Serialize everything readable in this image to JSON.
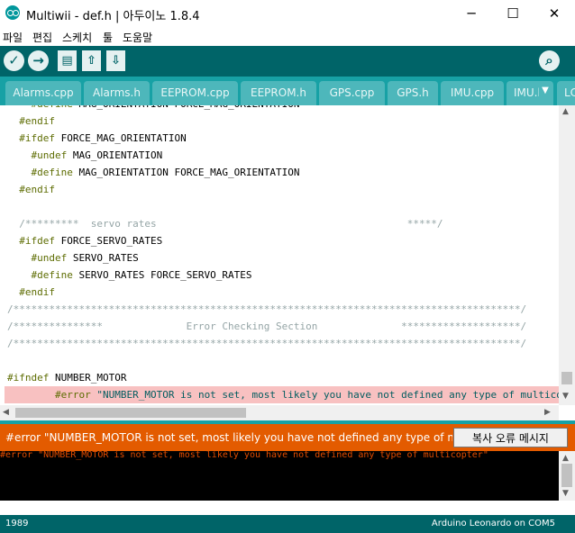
{
  "window": {
    "title": "Multiwii - def.h | 아두이노 1.8.4",
    "minimize": "─",
    "maximize": "☐",
    "close": "✕"
  },
  "menu": [
    "파일",
    "편집",
    "스케치",
    "툴",
    "도움말"
  ],
  "toolbar": {
    "verify_icon": "✓",
    "upload_icon": "→",
    "new_icon": "▤",
    "open_icon": "⇧",
    "save_icon": "⇩",
    "serial_icon": "⌕"
  },
  "tabs": [
    {
      "label": "Alarms.cpp"
    },
    {
      "label": "Alarms.h"
    },
    {
      "label": "EEPROM.cpp"
    },
    {
      "label": "EEPROM.h"
    },
    {
      "label": "GPS.cpp"
    },
    {
      "label": "GPS.h"
    },
    {
      "label": "IMU.cpp"
    },
    {
      "label": "IMU.h"
    },
    {
      "label": "LCD"
    }
  ],
  "tab_menu_icon": "▼",
  "code": [
    {
      "parts": [
        {
          "t": "    ",
          "c": ""
        },
        {
          "t": "#define",
          "c": "kw"
        },
        {
          "t": " MAG_ORIENTATION FORCE_MAG_ORIENTATION",
          "c": ""
        }
      ]
    },
    {
      "parts": [
        {
          "t": "  ",
          "c": ""
        },
        {
          "t": "#endif",
          "c": "kw"
        }
      ]
    },
    {
      "parts": [
        {
          "t": "  ",
          "c": ""
        },
        {
          "t": "#ifdef",
          "c": "kw"
        },
        {
          "t": " FORCE_MAG_ORIENTATION",
          "c": ""
        }
      ]
    },
    {
      "parts": [
        {
          "t": "    ",
          "c": ""
        },
        {
          "t": "#undef",
          "c": "kw"
        },
        {
          "t": " MAG_ORIENTATION",
          "c": ""
        }
      ]
    },
    {
      "parts": [
        {
          "t": "    ",
          "c": ""
        },
        {
          "t": "#define",
          "c": "kw"
        },
        {
          "t": " MAG_ORIENTATION FORCE_MAG_ORIENTATION",
          "c": ""
        }
      ]
    },
    {
      "parts": [
        {
          "t": "  ",
          "c": ""
        },
        {
          "t": "#endif",
          "c": "kw"
        }
      ]
    },
    {
      "parts": []
    },
    {
      "parts": [
        {
          "t": "  /*********  servo rates                                          *****/",
          "c": "cm"
        }
      ]
    },
    {
      "parts": [
        {
          "t": "  ",
          "c": ""
        },
        {
          "t": "#ifdef",
          "c": "kw"
        },
        {
          "t": " FORCE_SERVO_RATES",
          "c": ""
        }
      ]
    },
    {
      "parts": [
        {
          "t": "    ",
          "c": ""
        },
        {
          "t": "#undef",
          "c": "kw"
        },
        {
          "t": " SERVO_RATES",
          "c": ""
        }
      ]
    },
    {
      "parts": [
        {
          "t": "    ",
          "c": ""
        },
        {
          "t": "#define",
          "c": "kw"
        },
        {
          "t": " SERVO_RATES FORCE_SERVO_RATES",
          "c": ""
        }
      ]
    },
    {
      "parts": [
        {
          "t": "  ",
          "c": ""
        },
        {
          "t": "#endif",
          "c": "kw"
        }
      ]
    },
    {
      "parts": [
        {
          "t": "/*************************************************************************************/",
          "c": "cm"
        }
      ]
    },
    {
      "parts": [
        {
          "t": "/***************              Error Checking Section              ********************/",
          "c": "cm"
        }
      ]
    },
    {
      "parts": [
        {
          "t": "/*************************************************************************************/",
          "c": "cm"
        }
      ]
    },
    {
      "parts": []
    },
    {
      "parts": [
        {
          "t": "#ifndef",
          "c": "kw"
        },
        {
          "t": " NUMBER_MOTOR",
          "c": ""
        }
      ]
    },
    {
      "parts": [
        {
          "t": "        ",
          "c": ""
        },
        {
          "t": "#error",
          "c": "kw"
        },
        {
          "t": " \"NUMBER_MOTOR is not set, most likely you have not defined any type of multicopter\"",
          "c": "st"
        }
      ]
    }
  ],
  "error_bar": {
    "message": "#error \"NUMBER_MOTOR is not set, most likely you have not defined any type of multicopter\"",
    "copy_button": "복사 오류 메시지"
  },
  "console": {
    "text": "#error \"NUMBER_MOTOR is not set, most likely you have not defined any type of multicopter\""
  },
  "status": {
    "line": "1989",
    "board": "Arduino Leonardo on COM5"
  },
  "colors": {
    "toolbar": "#006468",
    "tabbar": "#17a1a5",
    "error_bar": "#e35b00",
    "error_highlight": "#f8c1c1"
  }
}
